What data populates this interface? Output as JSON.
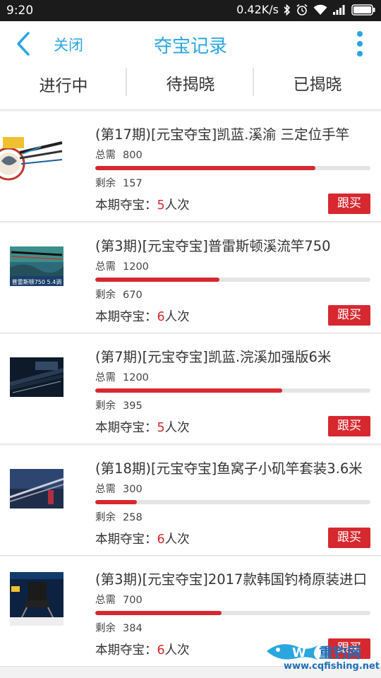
{
  "status_bar": {
    "time": "9:20",
    "network_speed": "0.42K/s"
  },
  "header": {
    "close_label": "关闭",
    "title": "夺宝记录",
    "accent_color": "#2ba6e0"
  },
  "tabs": [
    {
      "label": "进行中"
    },
    {
      "label": "待揭晓"
    },
    {
      "label": "已揭晓"
    }
  ],
  "labels": {
    "need": "总需",
    "remain": "剩余",
    "period_prefix": "本期夺宝：",
    "period_suffix": "人次",
    "follow_button": "跟买"
  },
  "items": [
    {
      "title": "(第17期)[元宝夺宝]凯蓝.溪渝 三定位手竿",
      "total": "800",
      "remaining": "157",
      "progress": 0.8,
      "count": "5",
      "thumb_text": ""
    },
    {
      "title": "(第3期)[元宝夺宝]普雷斯顿溪流竿750",
      "total": "1200",
      "remaining": "670",
      "progress": 0.45,
      "count": "6",
      "thumb_text": "普雷斯顿750 5.4调"
    },
    {
      "title": "(第7期)[元宝夺宝]凯蓝.浣溪加强版6米",
      "total": "1200",
      "remaining": "395",
      "progress": 0.68,
      "count": "5",
      "thumb_text": ""
    },
    {
      "title": "(第18期)[元宝夺宝]鱼窝子小矶竿套装3.6米",
      "total": "300",
      "remaining": "258",
      "progress": 0.15,
      "count": "6",
      "thumb_text": ""
    },
    {
      "title": "(第3期)[元宝夺宝]2017款韩国钓椅原装进口",
      "total": "700",
      "remaining": "384",
      "progress": 0.46,
      "count": "6",
      "thumb_text": ""
    }
  ],
  "watermark": {
    "brand": "重钓网",
    "url": "www.cqfishing.net"
  },
  "colors": {
    "accent": "#2ba6e0",
    "progress_fill": "#d7282f",
    "button": "#d7282f"
  }
}
